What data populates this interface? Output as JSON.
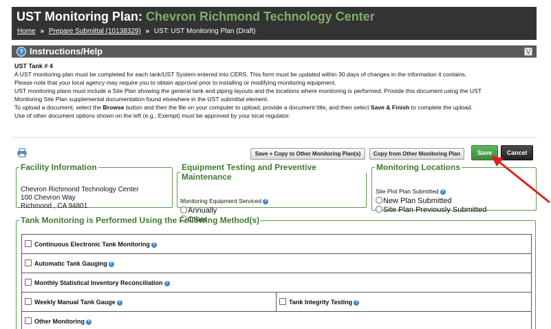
{
  "header": {
    "title_prefix": "UST Monitoring Plan:",
    "facility_name": "Chevron Richmond Technology Center",
    "breadcrumb": {
      "home": "Home",
      "separator": "»",
      "prepare": "Prepare Submittal (10138329)",
      "current": "UST: UST Monitoring Plan (Draft)"
    }
  },
  "help": {
    "title": "Instructions/Help",
    "icon": "help-circle-icon",
    "collapse_icon": "double-chevron-down-icon",
    "tank_label": "UST Tank # 4",
    "line1": "A UST monitoring plan must be completed for each tank/UST System entered into CERS. This form must be updated within 30 days of changes in the information it contains.",
    "line2": "Please note that your local agency may require you to obtain approval prior to installing or modifying monitoring equipment.",
    "line3": "UST monitoring plans must include a Site Plan showing the general tank and piping layouts and the locations where monitoring is performed. Provide this document using the UST",
    "line4": "Monitoring Site Plan supplemental documentation found elsewhere in the UST submittal element.",
    "line5_a": "To upload a document, select the ",
    "line5_b": "Browse",
    "line5_c": " button and then the file on your computer to upload, provide a document title, and then select ",
    "line5_d": "Save & Finish",
    "line5_e": " to complete the upload.",
    "line6": "Use of other document options shown on the left (e.g., Exempt) must be approved by your local regulator."
  },
  "toolbar": {
    "print_icon": "printer-icon",
    "save_copy_label": "Save + Copy to Other Monitoring Plan(s)",
    "copy_from_label": "Copy from Other Monitoring Plan",
    "save_label": "Save",
    "cancel_label": "Cancel"
  },
  "facility": {
    "legend": "Facility Information",
    "name": "Chevron Richmond Technology Center",
    "street": "100 Chevron Way",
    "city_line": "Richmond ,  CA  94801"
  },
  "equipment": {
    "legend": "Equipment Testing and Preventive Maintenance",
    "label": "Monitoring Equipment Serviced",
    "options": [
      "Annually",
      "Other"
    ]
  },
  "locations": {
    "legend": "Monitoring Locations",
    "label": "Site Plot Plan Submitted",
    "options": [
      "New Plan Submitted",
      "Site Plan Previously Submitted"
    ]
  },
  "methods": {
    "legend": "Tank Monitoring is Performed Using the Following Method(s)",
    "items": [
      "Continuous Electronic Tank Monitoring",
      "Automatic Tank Gauging",
      "Monthly Statistical Inventory Reconciliation",
      "Weekly Manual Tank Gauge",
      "Tank Integrity Testing",
      "Other Monitoring"
    ]
  },
  "colors": {
    "title_bar": "#333333",
    "facility_name": "#7fae6a",
    "legend_green": "#3f7a2e",
    "save_button": "#4cae4c",
    "annotation_arrow": "#e0201a"
  }
}
